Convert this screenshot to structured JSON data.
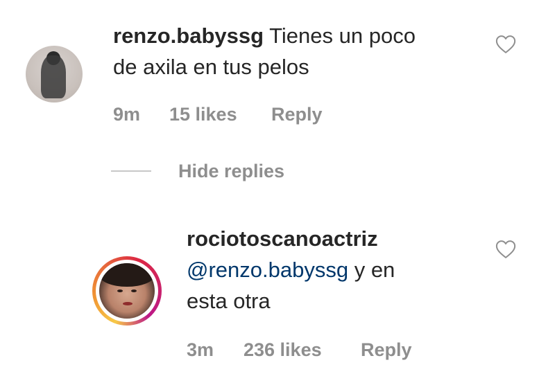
{
  "comment": {
    "username": "renzo.babyssg",
    "text_line1": "Tienes un poco",
    "text_line2": "de axila en tus pelos",
    "time": "9m",
    "likes": "15 likes",
    "reply_label": "Reply",
    "avatar_icon": "user-avatar-photo",
    "like_icon": "heart-outline-icon"
  },
  "replies_toggle": {
    "label": "Hide replies"
  },
  "reply": {
    "username": "rociotoscanoactriz",
    "mention": "@renzo.babyssg",
    "text_after_mention": " y en",
    "text_line2": "esta otra",
    "time": "3m",
    "likes": "236 likes",
    "reply_label": "Reply",
    "avatar_icon": "user-avatar-photo-with-story-ring",
    "like_icon": "heart-outline-icon"
  },
  "colors": {
    "text": "#262626",
    "meta": "#8e8e8e",
    "mention": "#00376b",
    "divider": "#c7c7c7"
  }
}
